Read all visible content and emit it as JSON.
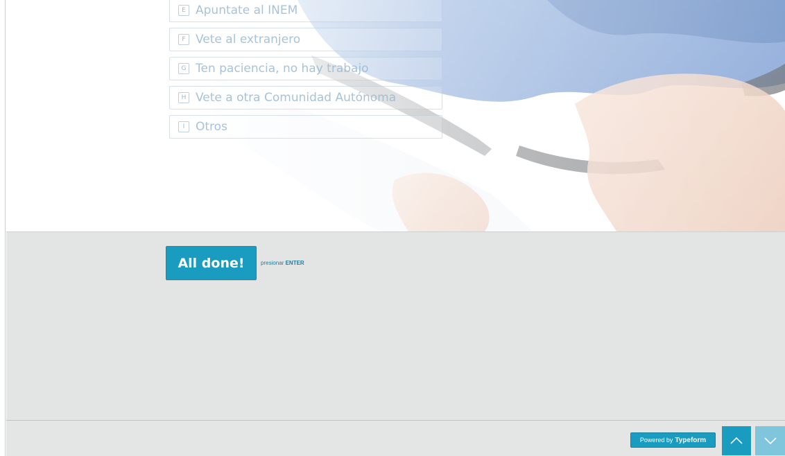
{
  "choices": [
    {
      "key": "E",
      "label": "Apuntate al INEM"
    },
    {
      "key": "F",
      "label": "Vete al extranjero"
    },
    {
      "key": "G",
      "label": "Ten paciencia, no hay trabajo"
    },
    {
      "key": "H",
      "label": "Vete a otra Comunidad Autónoma"
    },
    {
      "key": "I",
      "label": "Otros"
    }
  ],
  "submit": {
    "button_label": "All done!",
    "hint_prefix": "presionar",
    "hint_key": "ENTER"
  },
  "footer": {
    "powered_prefix": "Powered by",
    "powered_brand": "Typeform",
    "nav_up_icon": "chevron-up-icon",
    "nav_down_icon": "chevron-down-icon"
  },
  "colors": {
    "accent": "#1a9bc0",
    "accent_disabled": "#7fc6dc",
    "panel_bg": "#e3e4e4"
  }
}
